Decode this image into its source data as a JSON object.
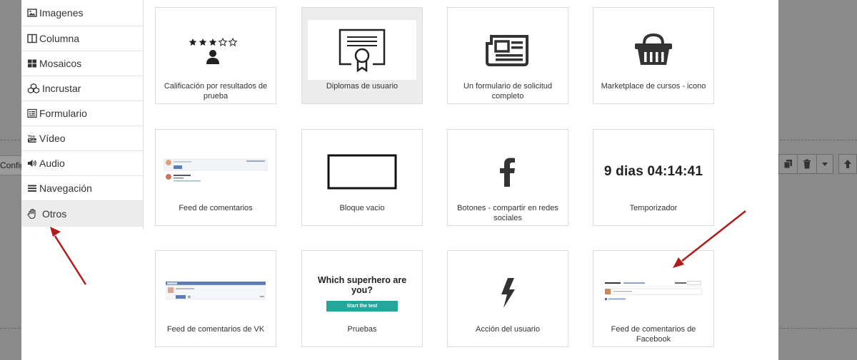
{
  "background": {
    "toolbar_label": "Config"
  },
  "sidebar": {
    "items": [
      {
        "label": "Imagenes",
        "icon": "image-icon"
      },
      {
        "label": "Columna",
        "icon": "column-icon"
      },
      {
        "label": "Mosaicos",
        "icon": "tiles-icon"
      },
      {
        "label": "Incrustar",
        "icon": "cubes-icon"
      },
      {
        "label": "Formulario",
        "icon": "form-icon"
      },
      {
        "label": "Vídeo",
        "icon": "youtube-icon"
      },
      {
        "label": "Audio",
        "icon": "volume-icon"
      },
      {
        "label": "Navegación",
        "icon": "menu-icon"
      },
      {
        "label": "Otros",
        "icon": "hand-icon"
      }
    ]
  },
  "blocks": [
    {
      "caption": "Calificación por resultados de prueba",
      "icon": "rating-person-icon"
    },
    {
      "caption": "Diplomas de usuario",
      "icon": "certificate-icon"
    },
    {
      "caption": "Un formulario de solicitud completo",
      "icon": "newspaper-icon"
    },
    {
      "caption": "Marketplace de cursos - icono",
      "icon": "basket-icon"
    },
    {
      "caption": "Feed de comentarios",
      "icon": "comment-feed-preview"
    },
    {
      "caption": "Bloque vacio",
      "icon": "empty-rectangle-icon"
    },
    {
      "caption": "Botones - compartir en redes sociales",
      "icon": "facebook-icon"
    },
    {
      "caption": "Temporizador",
      "timer_text": "9 dias 04:14:41"
    },
    {
      "caption": "Feed de comentarios de VK",
      "icon": "vk-feed-preview"
    },
    {
      "caption": "Pruebas",
      "quiz_question": "Which superhero are you?",
      "quiz_button": "Start the test"
    },
    {
      "caption": "Acción del usuario",
      "icon": "lightning-icon"
    },
    {
      "caption": "Feed de comentarios de Facebook",
      "icon": "facebook-feed-preview"
    }
  ],
  "colors": {
    "overlay": "#8a8a8a",
    "arrow": "#b01c1c",
    "quiz_button": "#26a69a",
    "active_item": "#ececec"
  }
}
